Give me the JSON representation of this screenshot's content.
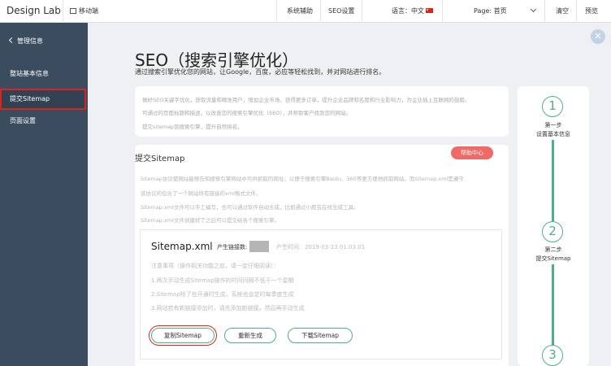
{
  "topbar": {
    "brand": "Design Lab",
    "mobile": "移动端",
    "assist": "系统辅助",
    "seo_settings": "SEO设置",
    "language_label": "语言：中文",
    "page_label": "Page: 首页",
    "clear": "清空",
    "preview": "预览"
  },
  "sidebar": {
    "back": "管理信息",
    "items": [
      "整站基本信息",
      "提交Sitemap",
      "页面设置"
    ]
  },
  "page": {
    "title": "SEO（搜索引擎优化）",
    "subtitle": "通过搜索引擎优化您的网站，让Google，百度，必应等轻松找到，并对网站进行排名。"
  },
  "intro": {
    "lines": [
      "做好SEO关键字优化，获取流量和精准用户，增加企业市场，获得更多订单，提升企业品牌和名度和行业影响力，为企业插上互联网的翅膀。",
      "可通过的页面标题和描述，以改善您的搜索引擎优化（SEO），并帮助客户找到您的网站。",
      "提交sitemap到搜索引擎，提升自然排名。"
    ]
  },
  "sitemap_section": {
    "title": "提交Sitemap",
    "help": "帮助中心",
    "desc": [
      "Sitemap协议使网站能够告知搜索引擎网站中可供抓取的网址，以便于搜索引擎Baidu、360等更方便地抓取网站。而Sitemap.xml是遵守",
      "该协议的包含了一个网站所有链接的xml格式文件。",
      "Sitemap.xml文件可以手工编写，也可以通过软件自动生成，比如通过小爬虫在线生成工具。",
      "Sitemap.xml文件创建好了之后可以提交给各个搜索引擎。"
    ],
    "file_title": "Sitemap.xml",
    "count_label": "产生链接数:",
    "time": "产生时间：2019-03-23 01:03:01",
    "notes": [
      "注意事项（操作相关功能之前，请一定仔细阅读）：",
      "1.两次手动生成Sitemap操作的时间间隔不低于一个星期",
      "2.Sitemap除了在开通时生成，系统也会定时每季度生成",
      "3.网站若有新链接添加时，请先添加新链接，然后再手动生成"
    ],
    "buttons": [
      "复制Sitemap",
      "重新生成",
      "下载Sitemap"
    ]
  },
  "steps": [
    {
      "num": "1",
      "label1": "第一步",
      "label2": "设置基本信息"
    },
    {
      "num": "2",
      "label1": "第二步",
      "label2": "提交Sitemap"
    },
    {
      "num": "3"
    }
  ],
  "colors": {
    "accent": "#4ab381",
    "sidebar": "#3b4c5e",
    "help": "#ef6a66",
    "highlight": "#d9261c"
  }
}
